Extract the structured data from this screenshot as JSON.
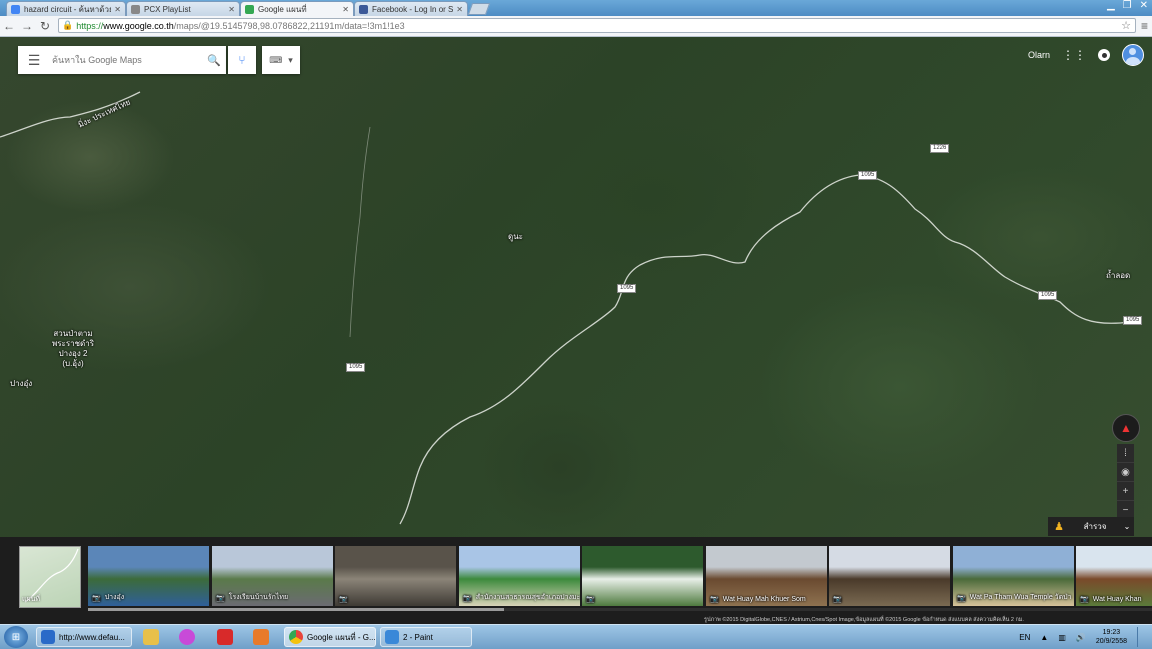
{
  "browser": {
    "tabs": [
      {
        "title": "hazard circuit - ค้นหาด้วย G",
        "favicon_color": "#4285f4",
        "active": false
      },
      {
        "title": "PCX PlayList",
        "favicon_color": "#888888",
        "active": false
      },
      {
        "title": "Google แผนที่",
        "favicon_color": "#34a853",
        "active": true
      },
      {
        "title": "Facebook - Log In or Sign",
        "favicon_color": "#3b5998",
        "active": false
      }
    ],
    "url": {
      "scheme": "https://",
      "host": "www.google.co.th",
      "path": "/maps/@19.5145798,98.0786822,21191m/data=!3m1!1e3"
    }
  },
  "maps": {
    "search_placeholder": "ค้นหาใน Google Maps",
    "user_name": "Olarn",
    "labels": [
      {
        "text": "มิ่งะ ประเทศไทย",
        "kind": "border"
      },
      {
        "text": "สวนป่าตาม พระราชดำริ ปางอุง 2 (บ.อุ้ง)",
        "kind": "place"
      },
      {
        "text": "ปางอุ๋ง",
        "kind": "place"
      },
      {
        "text": "ถ้ำลอด",
        "kind": "place"
      },
      {
        "text": "ดูนะ",
        "kind": "place"
      }
    ],
    "road_shields": [
      "1095",
      "1095",
      "1095",
      "1226",
      "1095",
      "1095"
    ],
    "explore_label": "สำรวจ",
    "minimap_label": "แผนที่",
    "photos": [
      {
        "caption": "ปางอุ๋ง",
        "colors": [
          "#5b86b8",
          "#3c6b3a",
          "#2f5f9a"
        ]
      },
      {
        "caption": "โรงเรียนบ้านรักไทย",
        "colors": [
          "#b9c7d9",
          "#5a7a4a",
          "#6b6b72"
        ]
      },
      {
        "caption": "",
        "colors": [
          "#59534a",
          "#8b8478",
          "#3e3a34"
        ]
      },
      {
        "caption": "สำนักงานสาธารณสุขอำเภอปางมะผ้า",
        "colors": [
          "#a9c5e6",
          "#3c8a3c",
          "#d8d3b8"
        ]
      },
      {
        "caption": "",
        "colors": [
          "#2d5a2d",
          "#e8efe8",
          "#4e7a3e"
        ]
      },
      {
        "caption": "Wat Huay Mah Khuer Som",
        "colors": [
          "#c3c9cf",
          "#6a4a30",
          "#8e7250"
        ]
      },
      {
        "caption": "",
        "colors": [
          "#d5dbe4",
          "#4a3a2a",
          "#7a6a52"
        ]
      },
      {
        "caption": "Wat Pa Tham Wua Temple วัดป่า",
        "colors": [
          "#8fb0d6",
          "#4a6a3a",
          "#d6c29a"
        ]
      },
      {
        "caption": "Wat Huay Khan",
        "colors": [
          "#d9e4ee",
          "#7a4a2a",
          "#5a7a3a"
        ]
      }
    ],
    "attribution": "รูปภาพ ©2015 DigitalGlobe,CNES / Astrium,Cnes/Spot Image,ข้อมูลแผนที่ ©2015 Google    ข้อกำหนด    ส่งแบบคล    ส่งความคิดเห็น    2 กม."
  },
  "taskbar": {
    "buttons": [
      {
        "label": "http://www.defau...",
        "icon_color": "#2a6ac8"
      },
      {
        "label": "Google แผนที่ - G...",
        "icon_color": "#e8453c"
      },
      {
        "label": "2 - Paint",
        "icon_color": "#3a88d8"
      }
    ],
    "pinned": [
      {
        "name": "folder-icon",
        "color": "#e8c04a"
      },
      {
        "name": "picasa-icon",
        "color": "#c84ad8"
      },
      {
        "name": "acrobat-icon",
        "color": "#d82a2a"
      },
      {
        "name": "media-player-icon",
        "color": "#e87a2a"
      }
    ],
    "language": "EN",
    "time": "19:23",
    "date": "20/9/2558"
  }
}
